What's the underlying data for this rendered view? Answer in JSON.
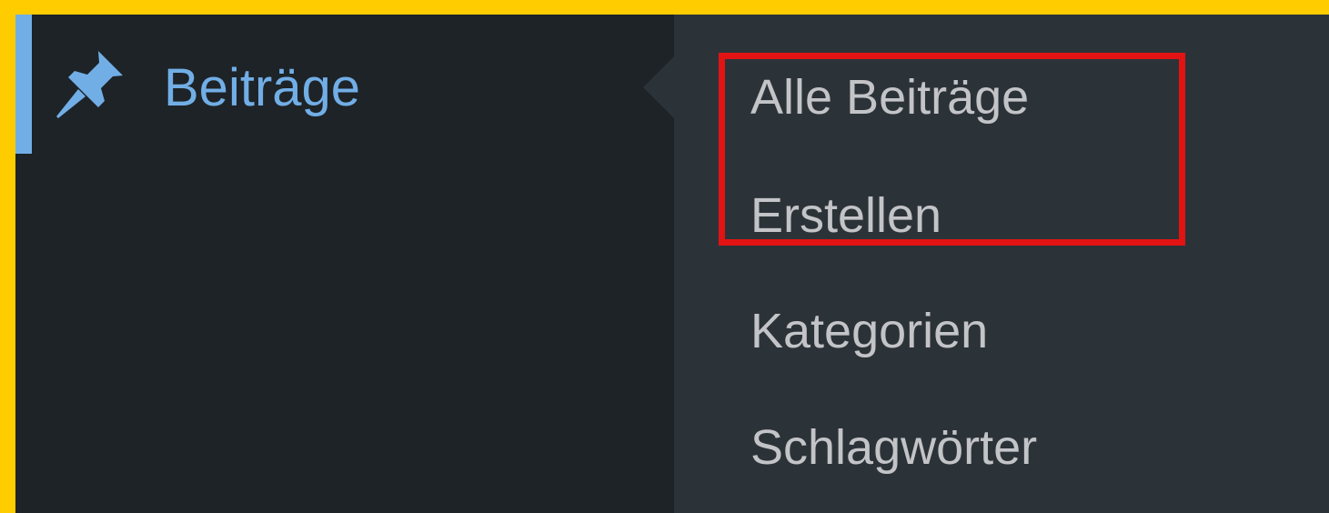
{
  "menu": {
    "parent_label": "Beiträge",
    "parent_icon": "pushpin-icon",
    "active_color": "#72aee6"
  },
  "submenu": {
    "items": [
      {
        "label": "Alle Beiträge"
      },
      {
        "label": "Erstellen"
      },
      {
        "label": "Kategorien"
      },
      {
        "label": "Schlagwörter"
      }
    ]
  },
  "annotation": {
    "highlight_color": "#e21313",
    "highlighted_items": [
      "Alle Beiträge",
      "Erstellen"
    ]
  },
  "colors": {
    "frame_border": "#ffcc00",
    "sidebar_bg": "#1d2327",
    "flyout_bg": "#2c3338",
    "submenu_text": "#c3c4c7"
  }
}
